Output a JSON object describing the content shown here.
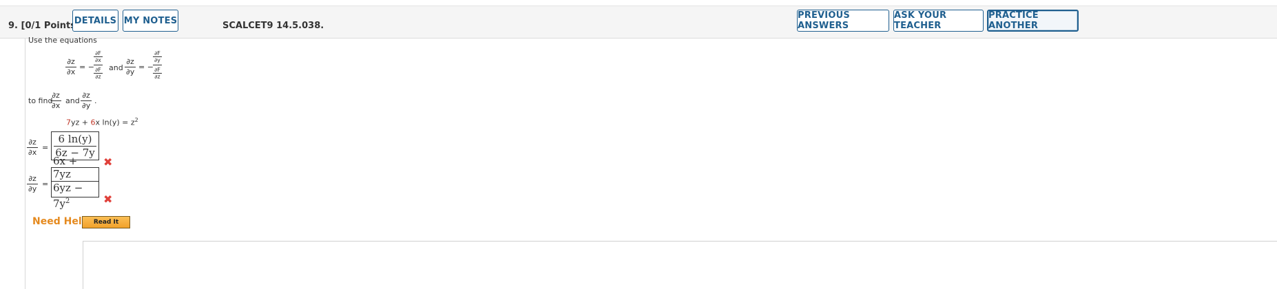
{
  "header": {
    "question_number": "9.",
    "points": "[0/1 Points]",
    "details_label": "DETAILS",
    "my_notes_label": "MY NOTES",
    "question_code": "SCALCET9 14.5.038.",
    "previous_answers_label": "PREVIOUS ANSWERS",
    "ask_teacher_label": "ASK YOUR TEACHER",
    "practice_another_label": "PRACTICE ANOTHER"
  },
  "problem": {
    "intro": "Use the equations",
    "eq1_lhs_num": "∂z",
    "eq1_lhs_den": "∂x",
    "eq1_sign": "= −",
    "eq1_rhs_num": "∂F / ∂x",
    "eq1_rhs_den": "∂F / ∂z",
    "eq1_rhs_num_top": "∂F",
    "eq1_rhs_num_bot": "∂x",
    "eq1_rhs_den_top": "∂F",
    "eq1_rhs_den_bot": "∂z",
    "and": "and",
    "eq2_lhs_num": "∂z",
    "eq2_lhs_den": "∂y",
    "eq2_sign": "= −",
    "eq2_rhs_num_top": "∂F",
    "eq2_rhs_num_bot": "∂y",
    "eq2_rhs_den_top": "∂F",
    "eq2_rhs_den_bot": "∂z",
    "to_find": "to find",
    "find1_num": "∂z",
    "find1_den": "∂x",
    "find2_num": "∂z",
    "find2_den": "∂y",
    "find_end": ".",
    "equation_part1": "7",
    "equation_part2": "yz + ",
    "equation_part3": "6",
    "equation_part4": "x ln(y) = z",
    "equation_exp": "2"
  },
  "answers": {
    "a1_lhs_num": "∂z",
    "a1_lhs_den": "∂x",
    "a1_equals": "=",
    "a1_num": "6 ln(y)",
    "a1_den": "6z − 7y",
    "a2_lhs_num": "∂z",
    "a2_lhs_den": "∂y",
    "a2_equals": "=",
    "a2_num": "6x + 7yz",
    "a2_den_base": "6yz − 7y",
    "a2_den_exp": "2",
    "incorrect_mark": "✖"
  },
  "help": {
    "need_help": "Need Help?",
    "read_it": "Read It"
  },
  "colors": {
    "button_blue": "#1f5f8f",
    "incorrect_red": "#e0403a",
    "help_orange": "#e58a1f",
    "highlight_red": "#c0392b"
  }
}
